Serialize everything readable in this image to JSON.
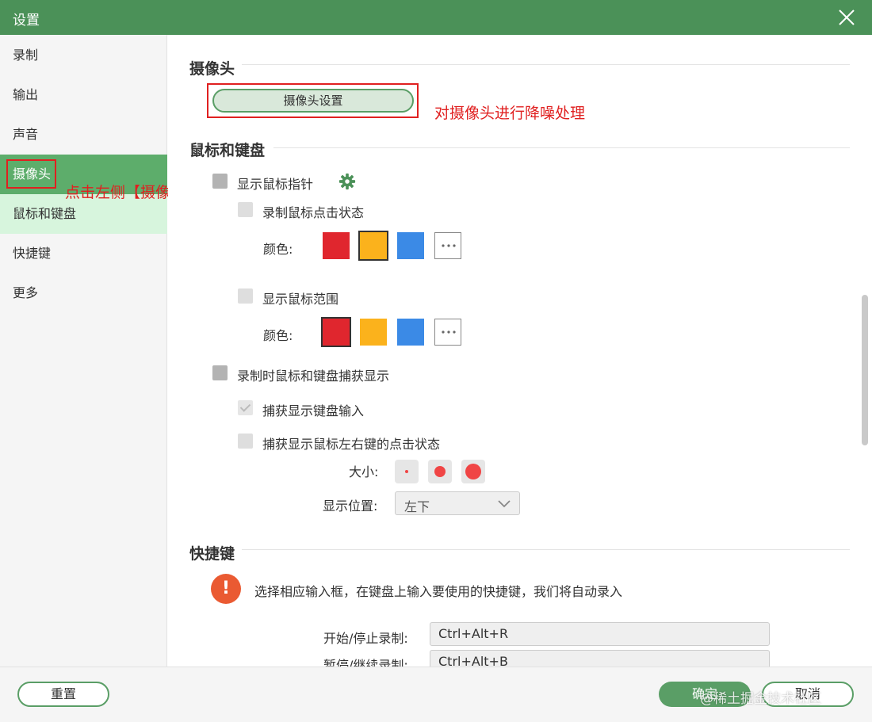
{
  "window": {
    "title": "设置"
  },
  "sidebar": {
    "items": [
      {
        "label": "录制"
      },
      {
        "label": "输出"
      },
      {
        "label": "声音"
      },
      {
        "label": "摄像头"
      },
      {
        "label": "鼠标和键盘"
      },
      {
        "label": "快捷键"
      },
      {
        "label": "更多"
      }
    ]
  },
  "annotations": {
    "sidebar_note": "点击左侧【摄像头】",
    "camera_note": "对摄像头进行降噪处理"
  },
  "camera_section": {
    "title": "摄像头",
    "settings_button": "摄像头设置"
  },
  "mouse_section": {
    "title": "鼠标和键盘",
    "show_pointer": "显示鼠标指针",
    "record_click_state": "录制鼠标点击状态",
    "color_label_1": "颜色:",
    "show_range": "显示鼠标范围",
    "color_label_2": "颜色:",
    "capture_display": "录制时鼠标和键盘捕获显示",
    "capture_keyboard": "捕获显示键盘输入",
    "capture_mouse_clicks": "捕获显示鼠标左右键的点击状态",
    "size_label": "大小:",
    "position_label": "显示位置:",
    "position_value": "左下"
  },
  "colors": {
    "red": "#e0262e",
    "orange": "#fbb21c",
    "blue": "#3b8ae6",
    "accent": "#5a9e66"
  },
  "hotkey_section": {
    "title": "快捷键",
    "hint": "选择相应输入框，在键盘上输入要使用的快捷键，我们将自动录入",
    "rows": [
      {
        "label": "开始/停止录制:",
        "value": "Ctrl+Alt+R"
      },
      {
        "label": "暂停/继续录制:",
        "value": "Ctrl+Alt+B"
      }
    ]
  },
  "footer": {
    "reset": "重置",
    "confirm": "确定",
    "cancel": "取消",
    "watermark": "@稀土掘金技术社区"
  }
}
